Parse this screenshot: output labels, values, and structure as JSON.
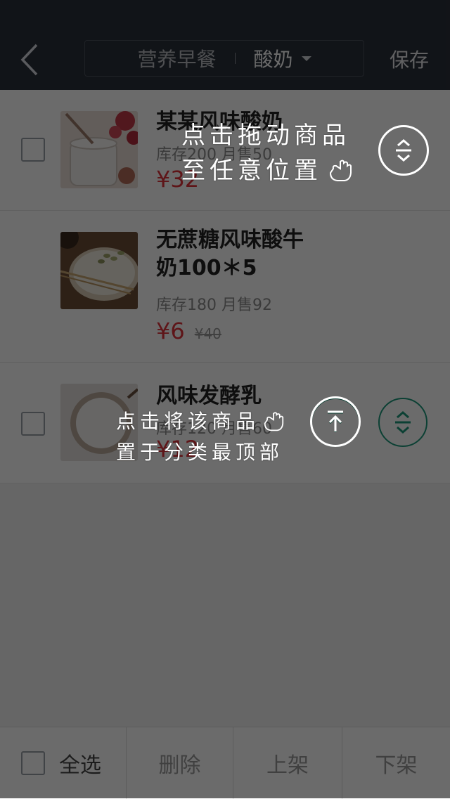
{
  "header": {
    "category_primary": "营养早餐",
    "category_secondary": "酸奶",
    "save_label": "保存"
  },
  "products": [
    {
      "name": "某某风味酸奶",
      "stats": "库存200 月售50",
      "price": "¥32"
    },
    {
      "name": "无蔗糖风味酸牛奶100＊5",
      "stats": "库存180  月售92",
      "price": "¥6",
      "old_price": "¥40"
    },
    {
      "name": "风味发酵乳",
      "stats": "库存120 月售60",
      "price": "¥12"
    }
  ],
  "tips": {
    "drag_line1": "点击拖动商品",
    "drag_line2": "至任意位置",
    "top_line1": "点击将该商品",
    "top_line2": "置于分类最顶部"
  },
  "footer": {
    "select_all": "全选",
    "delete": "删除",
    "shelve": "上架",
    "unshelve": "下架"
  },
  "colors": {
    "topbar": "#2a303a",
    "accent": "#1d9a7c",
    "price": "#e0323a",
    "overlay": "rgba(0,0,0,0.58)"
  },
  "icons": {
    "back": "chevron-left-icon",
    "dropdown": "caret-down-icon",
    "sort": "sort-drag-icon",
    "to_top": "pin-to-top-icon",
    "hand": "hand-pointer-icon"
  }
}
